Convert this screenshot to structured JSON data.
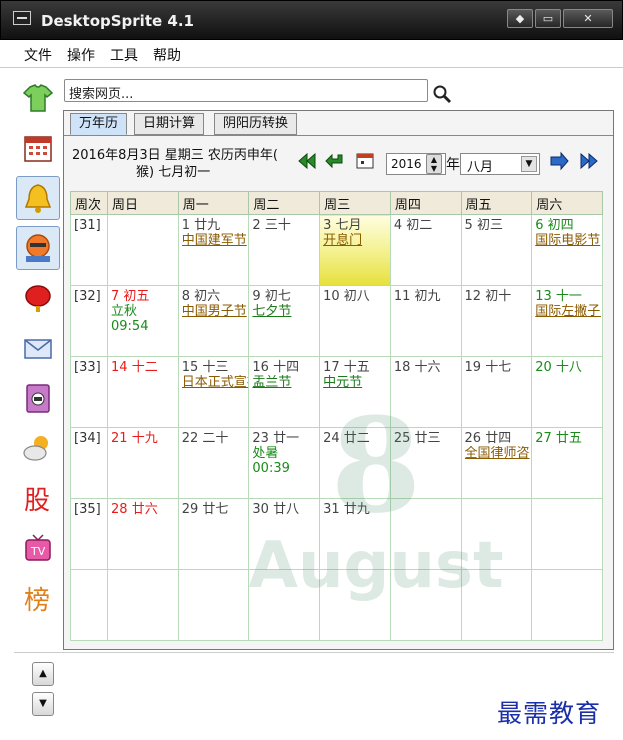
{
  "window": {
    "title": "DesktopSprite 4.1"
  },
  "menu": [
    "文件",
    "操作",
    "工具",
    "帮助"
  ],
  "search": {
    "value": "搜索网页..."
  },
  "tabs": [
    "万年历",
    "日期计算",
    "阴阳历转换"
  ],
  "header": {
    "line1": "2016年8月3日 星期三 农历丙申年(",
    "line2": "猴) 七月初一"
  },
  "year": "2016",
  "year_suffix": "年",
  "month": "八月",
  "columns": [
    "周次",
    "周日",
    "周一",
    "周二",
    "周三",
    "周四",
    "周五",
    "周六"
  ],
  "weeks": [
    {
      "wk": "[31]",
      "days": [
        null,
        {
          "num": "1",
          "lunar": "廿九",
          "fest": "中国建军节"
        },
        {
          "num": "2",
          "lunar": "三十"
        },
        {
          "num": "3",
          "lunar": "七月",
          "fest": "开息门",
          "today": true
        },
        {
          "num": "4",
          "lunar": "初二"
        },
        {
          "num": "5",
          "lunar": "初三"
        },
        {
          "num": "6",
          "lunar": "初四",
          "fest": "国际电影节"
        }
      ]
    },
    {
      "wk": "[32]",
      "days": [
        {
          "num": "7",
          "lunar": "初五",
          "term": "立秋",
          "time": "09:54"
        },
        {
          "num": "8",
          "lunar": "初六",
          "fest": "中国男子节"
        },
        {
          "num": "9",
          "lunar": "初七",
          "fest": "七夕节",
          "festGreen": true
        },
        {
          "num": "10",
          "lunar": "初八"
        },
        {
          "num": "11",
          "lunar": "初九"
        },
        {
          "num": "12",
          "lunar": "初十"
        },
        {
          "num": "13",
          "lunar": "十一",
          "fest": "国际左撇子日"
        }
      ]
    },
    {
      "wk": "[33]",
      "days": [
        {
          "num": "14",
          "lunar": "十二"
        },
        {
          "num": "15",
          "lunar": "十三",
          "fest": "日本正式宣布"
        },
        {
          "num": "16",
          "lunar": "十四",
          "fest": "盂兰节",
          "festGreen": true
        },
        {
          "num": "17",
          "lunar": "十五",
          "fest": "中元节",
          "festGreen": true
        },
        {
          "num": "18",
          "lunar": "十六"
        },
        {
          "num": "19",
          "lunar": "十七"
        },
        {
          "num": "20",
          "lunar": "十八"
        }
      ]
    },
    {
      "wk": "[34]",
      "days": [
        {
          "num": "21",
          "lunar": "十九"
        },
        {
          "num": "22",
          "lunar": "二十"
        },
        {
          "num": "23",
          "lunar": "廿一",
          "term": "处暑",
          "time": "00:39"
        },
        {
          "num": "24",
          "lunar": "廿二"
        },
        {
          "num": "25",
          "lunar": "廿三"
        },
        {
          "num": "26",
          "lunar": "廿四",
          "fest": "全国律师咨"
        },
        {
          "num": "27",
          "lunar": "廿五"
        }
      ]
    },
    {
      "wk": "[35]",
      "days": [
        {
          "num": "28",
          "lunar": "廿六"
        },
        {
          "num": "29",
          "lunar": "廿七"
        },
        {
          "num": "30",
          "lunar": "廿八"
        },
        {
          "num": "31",
          "lunar": "廿九"
        },
        null,
        null,
        null
      ]
    },
    {
      "wk": "",
      "days": [
        null,
        null,
        null,
        null,
        null,
        null,
        null
      ]
    }
  ],
  "watermark": {
    "big": "8",
    "word": "August"
  },
  "brand": "最需教育",
  "sidebar": [
    "tshirt-icon",
    "calendar-icon",
    "bell-icon",
    "avatar-icon",
    "lantern-icon",
    "mail-icon",
    "phone-icon",
    "weather-icon",
    "stock-icon",
    "tv-icon",
    "ranking-icon"
  ],
  "colors": {
    "today": "#f3f08a",
    "weekend": "#e81c1c",
    "saturday": "#1a8a1a",
    "accent": "#1b2fa8"
  }
}
